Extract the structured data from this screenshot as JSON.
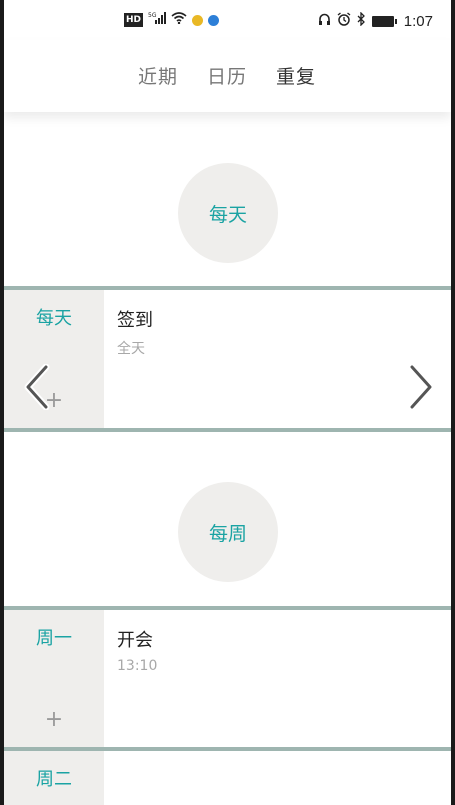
{
  "status_bar": {
    "hd": "HD",
    "network": "5G",
    "time": "1:07"
  },
  "tabs": [
    {
      "label": "近期",
      "active": false
    },
    {
      "label": "日历",
      "active": false
    },
    {
      "label": "重复",
      "active": true
    }
  ],
  "groups": [
    {
      "title": "每天",
      "rows": [
        {
          "day": "每天",
          "event_title": "签到",
          "event_sub": "全天"
        }
      ]
    },
    {
      "title": "每周",
      "rows": [
        {
          "day": "周一",
          "event_title": "开会",
          "event_sub": "13:10"
        },
        {
          "day": "周二",
          "event_title": "",
          "event_sub": ""
        }
      ]
    }
  ],
  "colors": {
    "accent_teal": "#1aa3a3",
    "tab_underline": "#e2403f",
    "divider": "#9eb5b0",
    "panel_gray": "#efeeec"
  }
}
